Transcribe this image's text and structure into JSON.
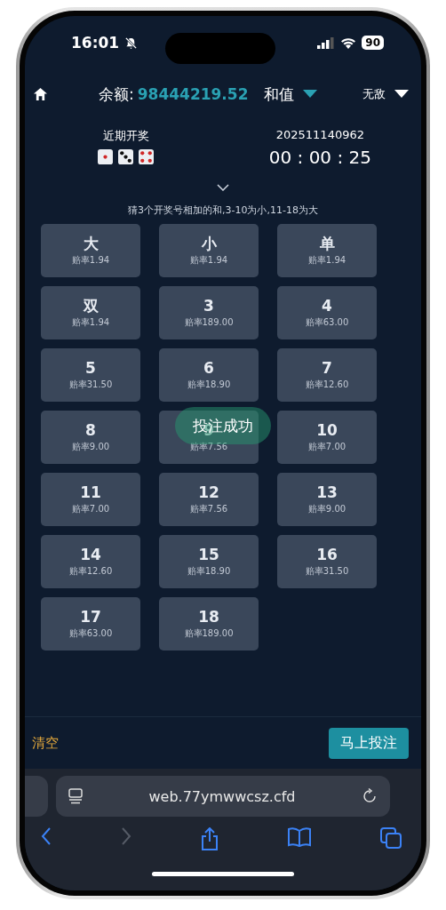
{
  "status_bar": {
    "time": "16:01",
    "battery": "90",
    "silent": true
  },
  "header": {
    "balance_label": "余额:",
    "balance": "98444219.52",
    "game": "和值",
    "mode": "无敌"
  },
  "draw": {
    "label": "近期开奖",
    "dice": [
      {
        "kind": "one"
      },
      {
        "kind": "three"
      },
      {
        "kind": "four"
      }
    ],
    "period": "202511140962",
    "countdown": "00 : 00 : 25"
  },
  "hint": "猜3个开奖号相加的和,3-10为小,11-18为大",
  "options": [
    {
      "label": "大",
      "odds": "赔率1.94"
    },
    {
      "label": "小",
      "odds": "赔率1.94"
    },
    {
      "label": "单",
      "odds": "赔率1.94"
    },
    {
      "label": "双",
      "odds": "赔率1.94"
    },
    {
      "label": "3",
      "odds": "赔率189.00"
    },
    {
      "label": "4",
      "odds": "赔率63.00"
    },
    {
      "label": "5",
      "odds": "赔率31.50"
    },
    {
      "label": "6",
      "odds": "赔率18.90"
    },
    {
      "label": "7",
      "odds": "赔率12.60"
    },
    {
      "label": "8",
      "odds": "赔率9.00"
    },
    {
      "toast": "投注成功",
      "label": "9",
      "odds": "赔率7.56"
    },
    {
      "label": "10",
      "odds": "赔率7.00"
    },
    {
      "label": "11",
      "odds": "赔率7.00"
    },
    {
      "label": "12",
      "odds": "赔率7.56"
    },
    {
      "label": "13",
      "odds": "赔率9.00"
    },
    {
      "label": "14",
      "odds": "赔率12.60"
    },
    {
      "label": "15",
      "odds": "赔率18.90"
    },
    {
      "label": "16",
      "odds": "赔率31.50"
    },
    {
      "label": "17",
      "odds": "赔率63.00"
    },
    {
      "label": "18",
      "odds": "赔率189.00"
    }
  ],
  "footer": {
    "clear": "清空",
    "submit": "马上投注"
  },
  "browser": {
    "url": "web.77ymwwcsz.cfd",
    "back_disabled": false,
    "forward_disabled": true
  }
}
